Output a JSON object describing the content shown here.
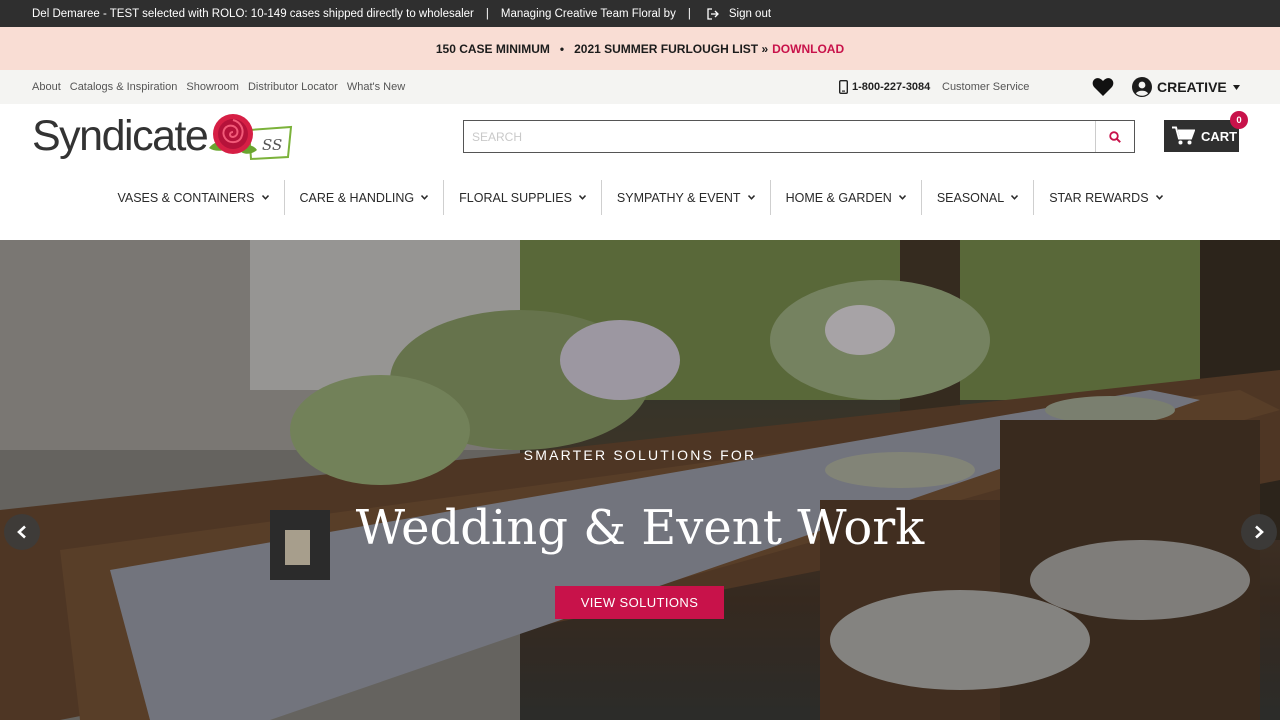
{
  "topbar": {
    "status_text": "Del Demaree - TEST selected with ROLO: 10-149 cases shipped directly to wholesaler",
    "separator": "|",
    "managing_text": "Managing Creative Team Floral by",
    "signout_label": "Sign out"
  },
  "promo": {
    "minimum_text": "150 CASE MINIMUM",
    "bullet": "•",
    "furlough_text": "2021 SUMMER FURLOUGH LIST »",
    "download_label": "DOWNLOAD",
    "download_color": "#c8124a"
  },
  "utility": {
    "links": [
      "About",
      "Catalogs & Inspiration",
      "Showroom",
      "Distributor Locator",
      "What's New"
    ],
    "phone": "1-800-227-3084",
    "customer_service": "Customer Service",
    "account_label": "CREATIVE",
    "icons": [
      "phone-icon",
      "heart-icon",
      "user-icon",
      "chevron-down-icon"
    ]
  },
  "header": {
    "logo_text": "Syndicate",
    "search_placeholder": "SEARCH",
    "cart_label": "CART",
    "cart_count": "0"
  },
  "nav": {
    "items": [
      "VASES & CONTAINERS",
      "CARE & HANDLING",
      "FLORAL SUPPLIES",
      "SYMPATHY & EVENT",
      "HOME & GARDEN",
      "SEASONAL",
      "STAR REWARDS"
    ]
  },
  "hero": {
    "kicker": "SMARTER SOLUTIONS FOR",
    "headline": "Wedding & Event Work",
    "cta_label": "VIEW SOLUTIONS",
    "accent_color": "#c8124a"
  }
}
